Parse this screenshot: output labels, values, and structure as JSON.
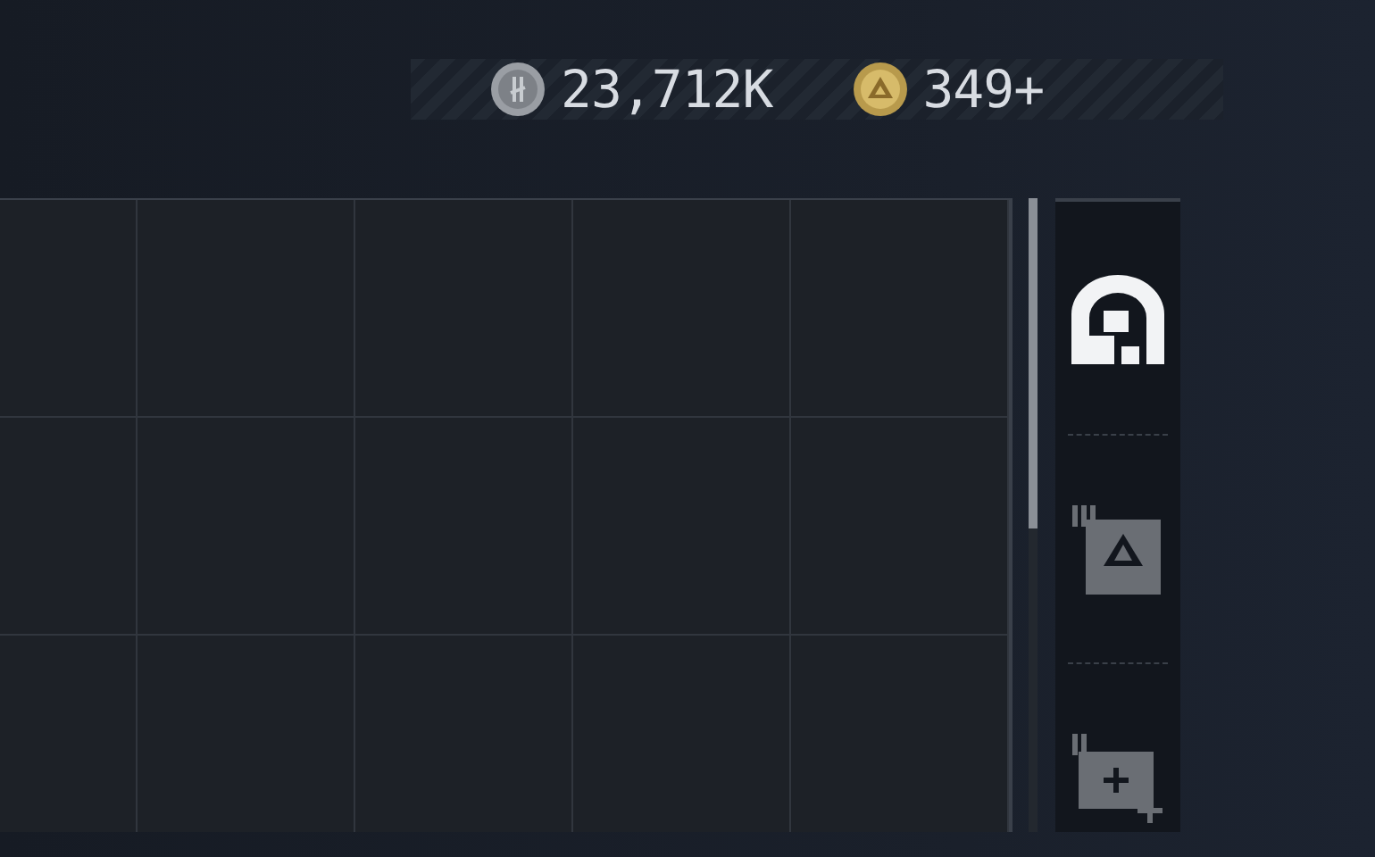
{
  "currencies": [
    {
      "kind": "silver",
      "amount": "23,712K"
    },
    {
      "kind": "gold",
      "amount": "349+"
    }
  ],
  "side_tabs": [
    {
      "kind": "vault",
      "selected": true
    },
    {
      "kind": "tiered-triangle",
      "selected": false
    },
    {
      "kind": "tiered-plus",
      "selected": false
    }
  ]
}
